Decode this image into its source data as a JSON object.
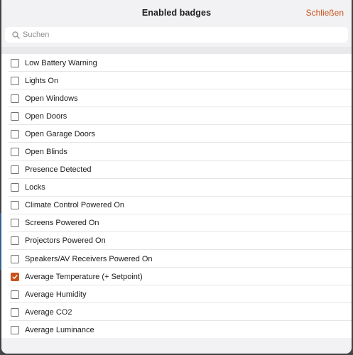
{
  "dialog": {
    "title": "Enabled badges",
    "close_label": "Schließen"
  },
  "search": {
    "placeholder": "Suchen",
    "value": ""
  },
  "accent_color": "#c9521a",
  "items": [
    {
      "label": "Low Battery Warning",
      "checked": false
    },
    {
      "label": "Lights On",
      "checked": false
    },
    {
      "label": "Open Windows",
      "checked": false
    },
    {
      "label": "Open Doors",
      "checked": false
    },
    {
      "label": "Open Garage Doors",
      "checked": false
    },
    {
      "label": "Open Blinds",
      "checked": false
    },
    {
      "label": "Presence Detected",
      "checked": false
    },
    {
      "label": "Locks",
      "checked": false
    },
    {
      "label": "Climate Control Powered On",
      "checked": false
    },
    {
      "label": "Screens Powered On",
      "checked": false
    },
    {
      "label": "Projectors Powered On",
      "checked": false
    },
    {
      "label": "Speakers/AV Receivers Powered On",
      "checked": false
    },
    {
      "label": "Average Temperature (+ Setpoint)",
      "checked": true
    },
    {
      "label": "Average Humidity",
      "checked": false
    },
    {
      "label": "Average CO2",
      "checked": false
    },
    {
      "label": "Average Luminance",
      "checked": false
    }
  ]
}
